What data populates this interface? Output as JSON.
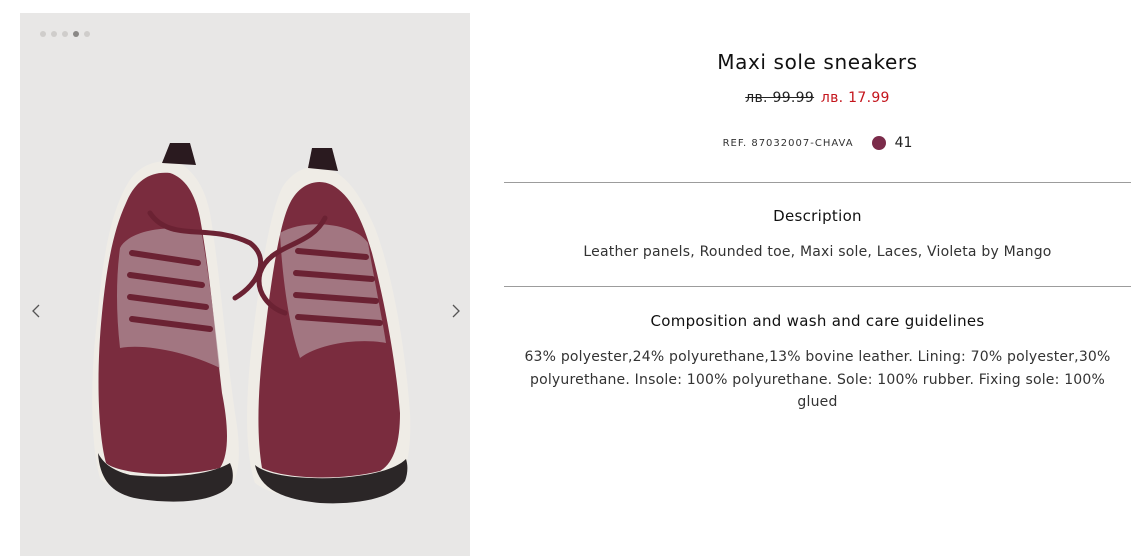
{
  "gallery": {
    "slide_count": 5,
    "active_index": 3,
    "prev_icon": "chevron-left-icon",
    "next_icon": "chevron-right-icon",
    "shoe_color": "#7a2c3e"
  },
  "product": {
    "title": "Maxi sole sneakers",
    "old_price": "лв. 99.99",
    "new_price": "лв. 17.99",
    "ref": "REF. 87032007-CHAVA",
    "color_swatch": "#7b2b4a",
    "size": "41"
  },
  "description": {
    "heading": "Description",
    "text": "Leather panels, Rounded toe, Maxi sole, Laces, Violeta by Mango"
  },
  "composition": {
    "heading": "Composition and wash and care guidelines",
    "text": "63% polyester,24% polyurethane,13% bovine leather. Lining: 70% polyester,30% polyurethane. Insole: 100% polyurethane. Sole: 100% rubber. Fixing sole: 100% glued"
  },
  "colors": {
    "sale_price": "#c4151c",
    "divider": "#9c9c9c"
  }
}
